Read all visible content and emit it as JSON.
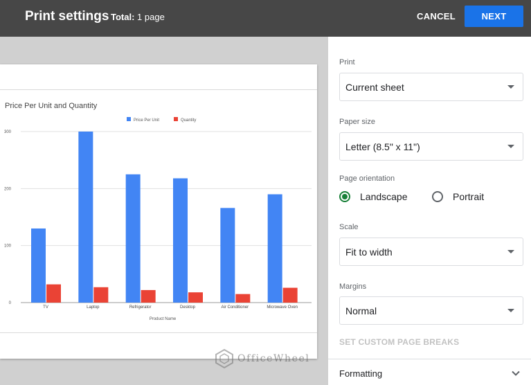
{
  "topbar": {
    "title": "Print settings",
    "total_label": "Total:",
    "total_value": "1 page",
    "cancel_label": "CANCEL",
    "next_label": "NEXT",
    "next_color": "#1a73e8"
  },
  "panel": {
    "print_label": "Print",
    "print_value": "Current sheet",
    "paper_label": "Paper size",
    "paper_value": "Letter (8.5\" x 11\")",
    "orientation_label": "Page orientation",
    "orientation_options": [
      "Landscape",
      "Portrait"
    ],
    "orientation_selected": "Landscape",
    "scale_label": "Scale",
    "scale_value": "Fit to width",
    "margins_label": "Margins",
    "margins_value": "Normal",
    "custom_breaks_label": "SET CUSTOM PAGE BREAKS",
    "formatting_label": "Formatting",
    "accent_color": "#188038"
  },
  "watermark": "OfficeWheel",
  "chart_data": {
    "type": "bar",
    "title": "Price Per Unit and Quantity",
    "xlabel": "Product Name",
    "ylabel": "",
    "categories": [
      "TV",
      "Laptop",
      "Refrigerator",
      "Desktop",
      "Air Conditioner",
      "Microwave Oven"
    ],
    "series": [
      {
        "name": "Price Per Unit",
        "color": "#4285f4",
        "values": [
          130,
          300,
          225,
          218,
          166,
          190
        ]
      },
      {
        "name": "Quantity",
        "color": "#ea4335",
        "values": [
          32,
          27,
          22,
          18,
          15,
          26
        ]
      }
    ],
    "yticks": [
      0,
      100,
      200,
      300
    ],
    "ylim": [
      0,
      310
    ],
    "grid": true,
    "legend": "top-center"
  }
}
